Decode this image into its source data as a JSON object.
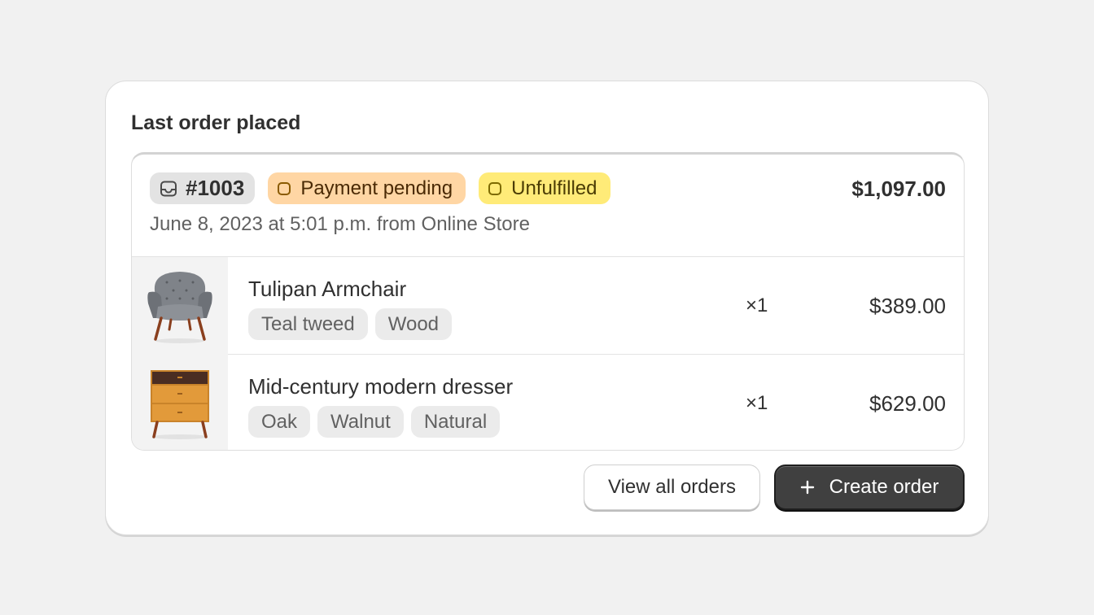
{
  "card": {
    "title": "Last order placed"
  },
  "order": {
    "number": "#1003",
    "payment_status": "Payment pending",
    "fulfillment_status": "Unfulfilled",
    "total": "$1,097.00",
    "meta": "June 8, 2023 at 5:01 p.m. from Online Store",
    "status_colors": {
      "payment_bg": "#ffd6a4",
      "unfulfilled_bg": "#ffeb78"
    }
  },
  "line_items": [
    {
      "name": "Tulipan Armchair",
      "tags": [
        "Teal tweed",
        "Wood"
      ],
      "quantity": "×1",
      "price": "$389.00",
      "thumbnail_icon": "armchair-image"
    },
    {
      "name": "Mid-century modern dresser",
      "tags": [
        "Oak",
        "Walnut",
        "Natural"
      ],
      "quantity": "×1",
      "price": "$629.00",
      "thumbnail_icon": "dresser-image"
    }
  ],
  "actions": {
    "view_all_label": "View all orders",
    "create_label": "Create order",
    "create_icon": "plus-icon"
  },
  "colors": {
    "primary_button": "#404040",
    "page_bg": "#f1f1f1"
  }
}
